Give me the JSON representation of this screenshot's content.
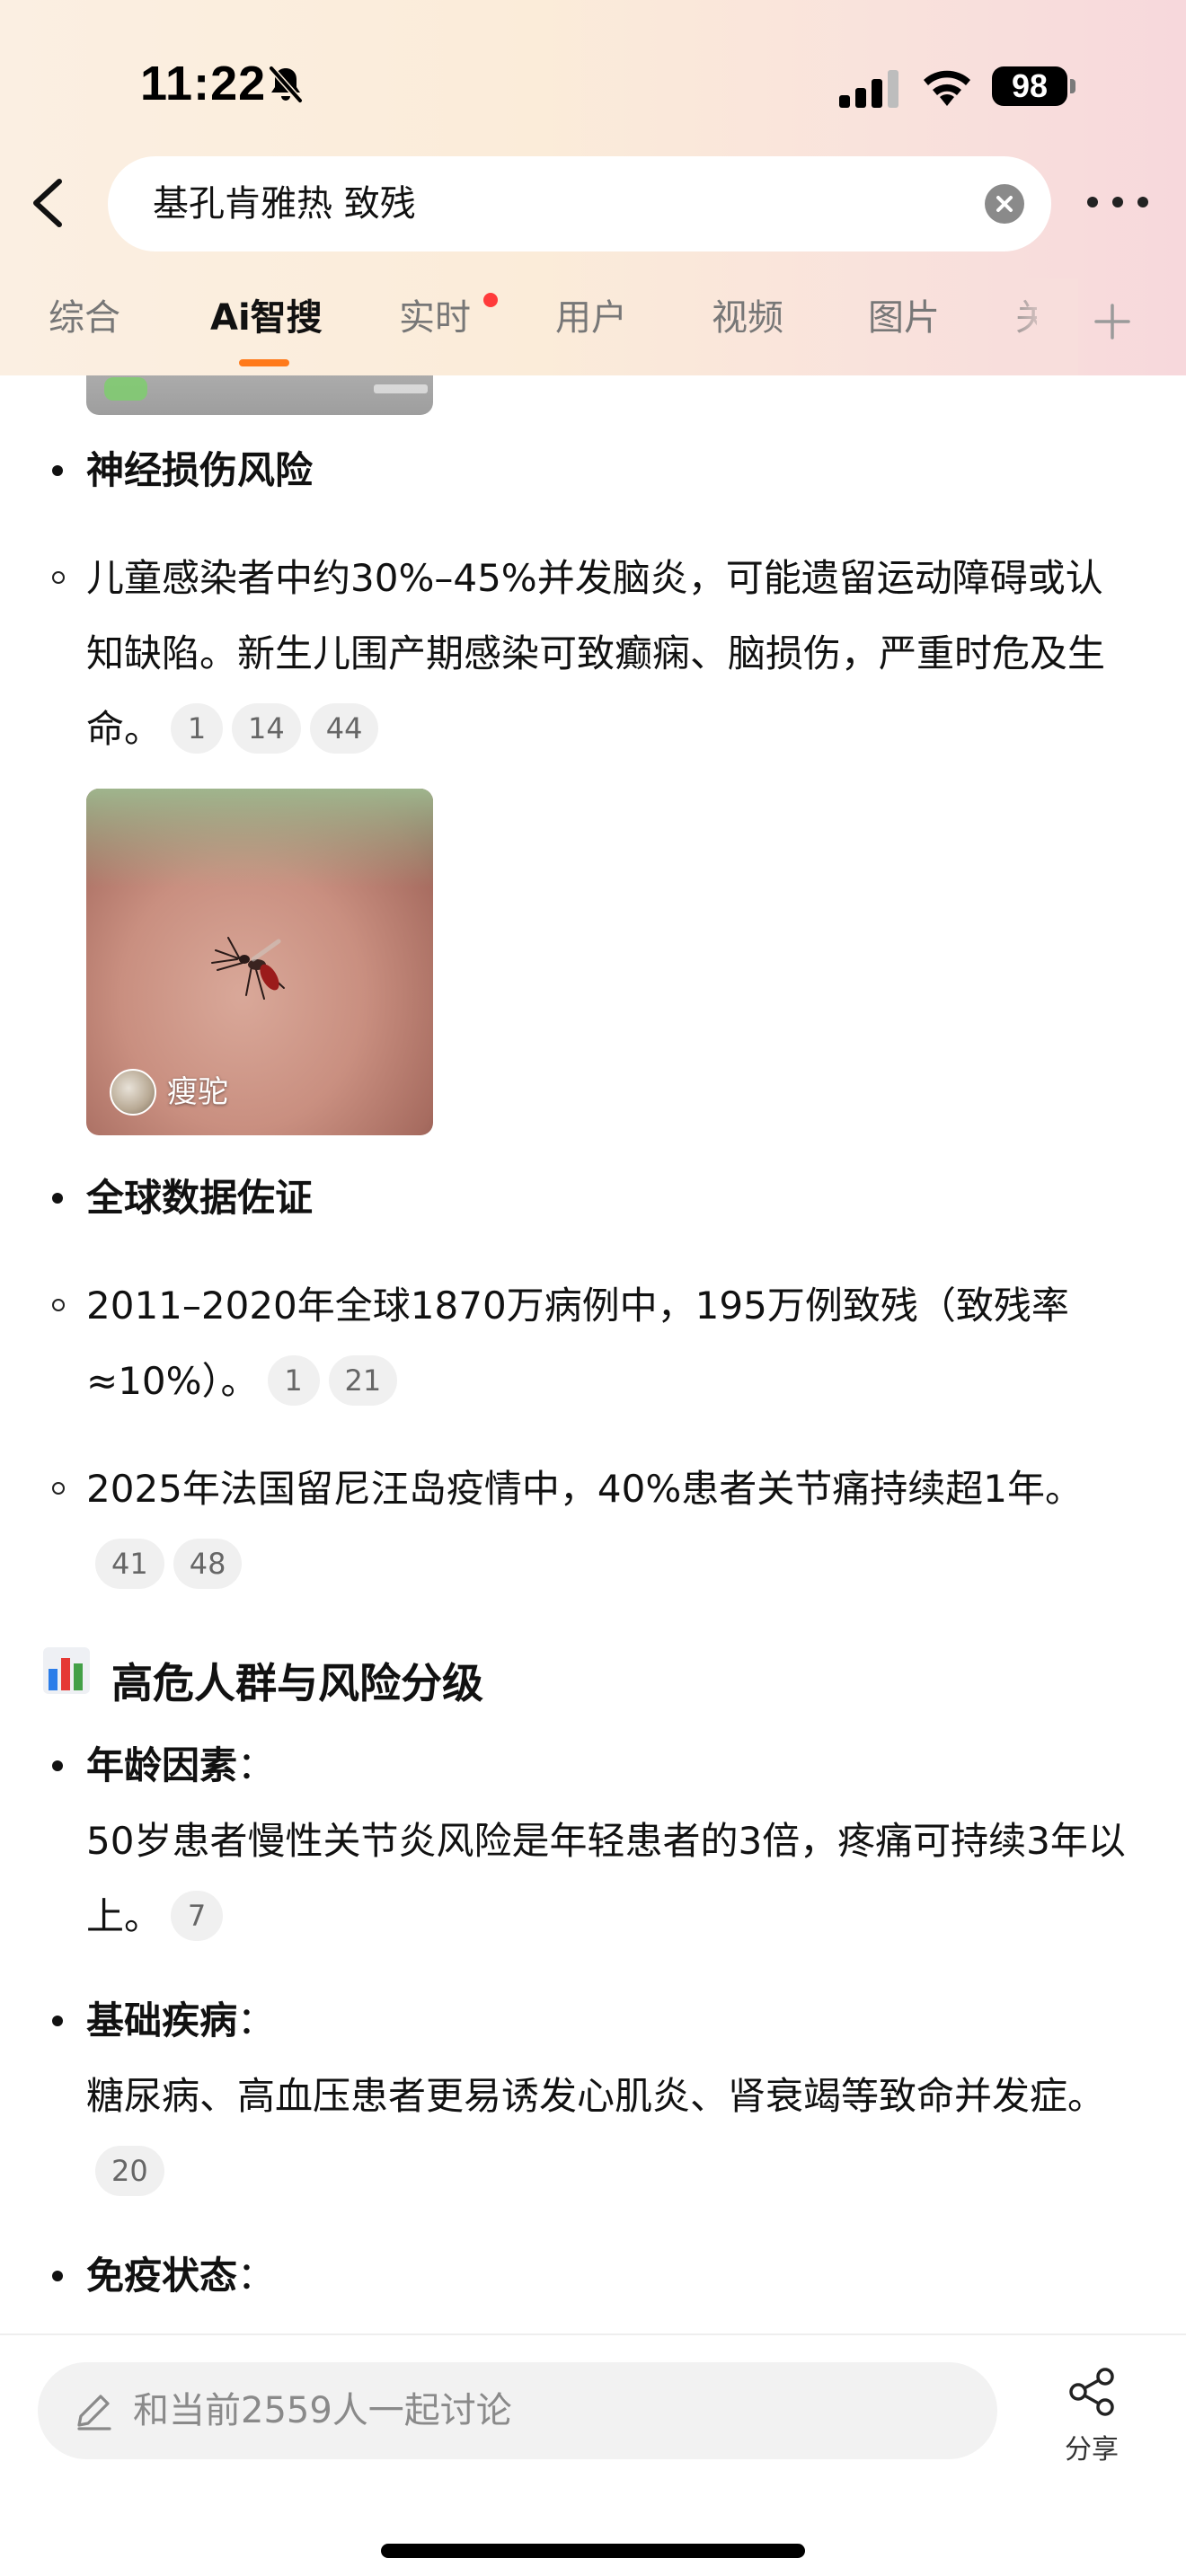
{
  "status_bar": {
    "time": "11:22",
    "battery": "98",
    "icons": [
      "bell-off-icon",
      "signal-icon",
      "wifi-icon",
      "battery-icon"
    ]
  },
  "nav": {
    "search_query": "基孔肯雅热 致残",
    "icons": [
      "back-icon",
      "clear-icon",
      "more-icon"
    ]
  },
  "tabs": [
    {
      "label": "综合",
      "active": false
    },
    {
      "label": "Ai智搜",
      "active": true
    },
    {
      "label": "实时",
      "active": false,
      "dot": true
    },
    {
      "label": "用户",
      "active": false
    },
    {
      "label": "视频",
      "active": false
    },
    {
      "label": "图片",
      "active": false
    },
    {
      "label": "关",
      "active": false,
      "clipped": true
    }
  ],
  "accent_color": "#ff7a1a",
  "content": {
    "neuro": {
      "heading": "神经损伤风险",
      "text": "儿童感染者中约30%–45%并发脑炎，可能遗留运动障碍或认知缺陷。新生儿围产期感染可致癫痫、脑损伤，严重时危及生命。",
      "cites": [
        "1",
        "14",
        "44"
      ]
    },
    "image_card": {
      "author": "瘦驼"
    },
    "global": {
      "heading": "全球数据佐证",
      "item1": {
        "text": "2011–2020年全球1870万病例中，195万例致残（致残率≈10%）。",
        "cites": [
          "1",
          "21"
        ]
      },
      "item2": {
        "text": "2025年法国留尼汪岛疫情中，40%患者关节痛持续超1年。",
        "cites": [
          "41",
          "48"
        ]
      }
    },
    "risk": {
      "title": "高危人群与风险分级",
      "age": {
        "label": "年龄因素",
        "text": "50岁患者慢性关节炎风险是年轻患者的3倍，疼痛可持续3年以上。",
        "cites": [
          "7"
        ]
      },
      "disease": {
        "label": "基础疾病",
        "text": "糖尿病、高血压患者更易诱发心肌炎、肾衰竭等致命并发症。",
        "cites": [
          "20"
        ]
      },
      "immune": {
        "label": "免疫状态"
      }
    }
  },
  "bottom": {
    "comment_placeholder": "和当前2559人一起讨论",
    "share_label": "分享"
  }
}
